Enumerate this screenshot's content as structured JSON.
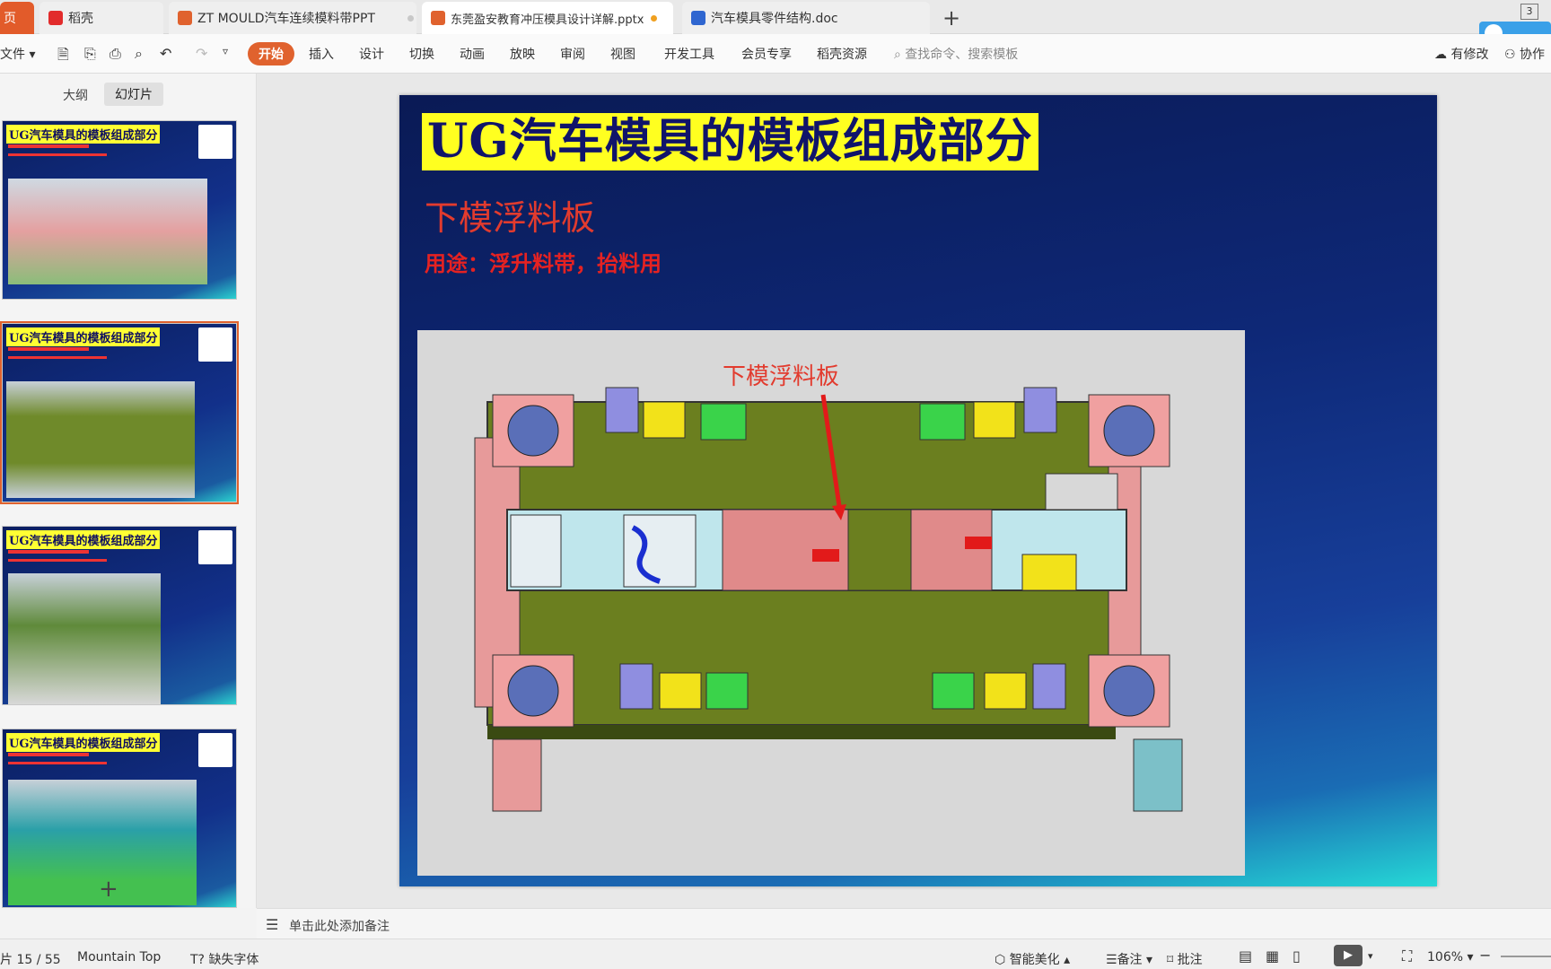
{
  "tabs": [
    {
      "label": "页",
      "color": "#e25b2a"
    },
    {
      "label": "稻壳",
      "color": "#e22b2b"
    },
    {
      "label": "ZT MOULD汽车连续模料带PPT",
      "color": "#e0622e"
    },
    {
      "label": "东莞盈安教育冲压模具设计详解.pptx",
      "color": "#e0622e"
    },
    {
      "label": "汽车模具零件结构.doc",
      "color": "#2f66d0"
    }
  ],
  "window_badge": "3",
  "toolbar": {
    "file": "文件",
    "ribbon_tabs": [
      "开始",
      "插入",
      "设计",
      "切换",
      "动画",
      "放映",
      "审阅",
      "视图",
      "开发工具",
      "会员专享",
      "稻壳资源"
    ],
    "search_placeholder": "查找命令、搜索模板",
    "modified": "有修改",
    "collab": "协作"
  },
  "panel": {
    "tab_outline": "大纲",
    "tab_slides": "幻灯片",
    "thumb_title": "UG汽车模具的模板组成部分",
    "add": "+"
  },
  "slide": {
    "title": "UG汽车模具的模板组成部分",
    "subtitle": "下模浮料板",
    "usage": "用途：浮升料带，抬料用",
    "callout": "下模浮料板"
  },
  "notes_placeholder": "单击此处添加备注",
  "status": {
    "page": "片 15 / 55",
    "theme": "Mountain Top",
    "missing_font": "缺失字体",
    "beautify": "智能美化",
    "notes": "备注",
    "comments": "批注",
    "zoom": "106%"
  },
  "colors": {
    "accent": "#e0622e",
    "title_bg": "#ffff20",
    "title_fg": "#10146a",
    "red_text": "#e23b2e"
  }
}
